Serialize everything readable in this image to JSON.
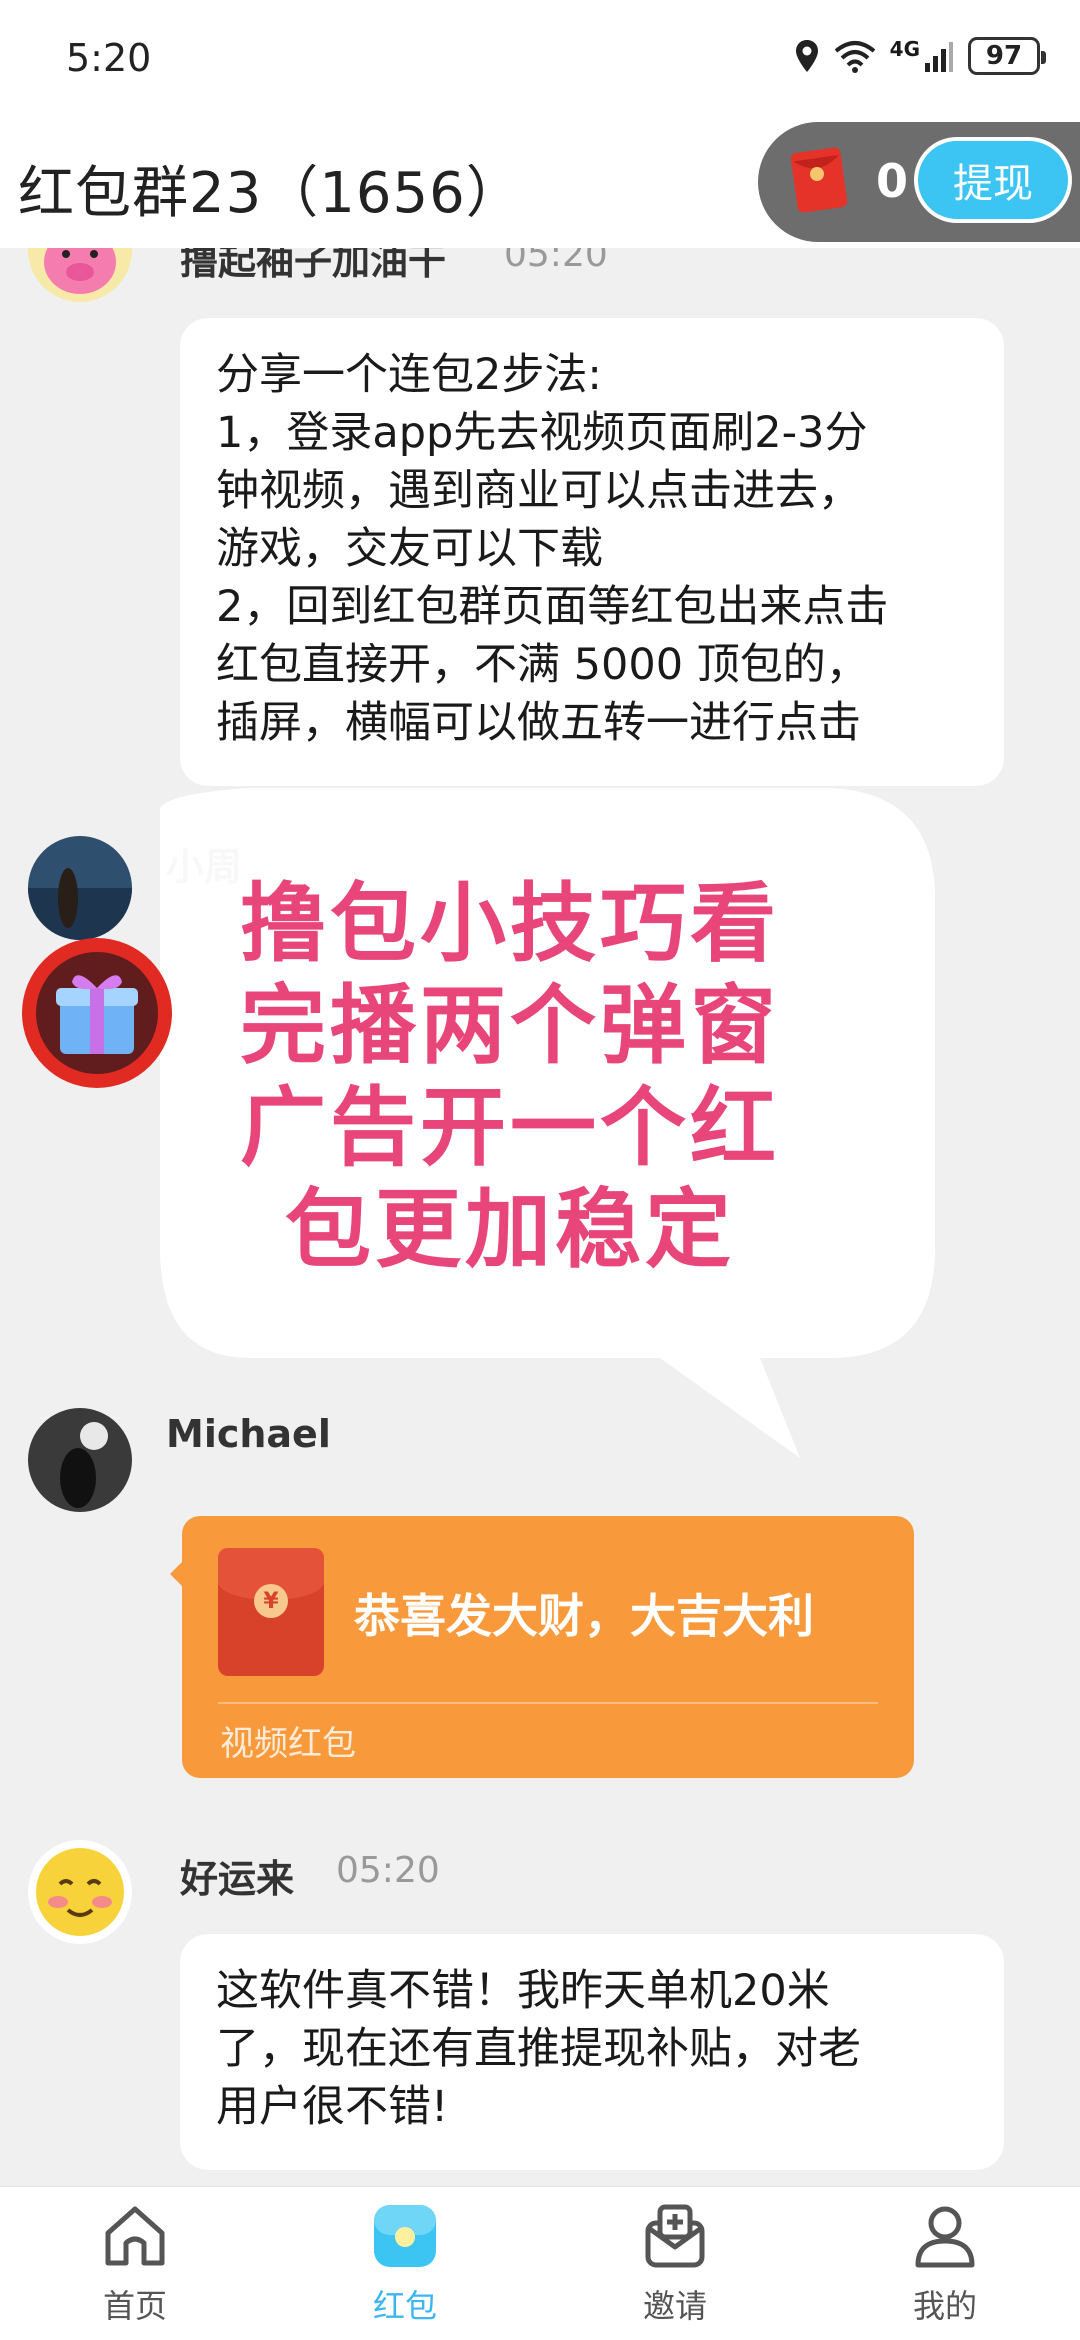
{
  "status_bar": {
    "time": "5:20",
    "battery": "97",
    "network": "4G"
  },
  "header": {
    "title": "红包群23（1656）",
    "wallet_count": "0",
    "withdraw_label": "提现"
  },
  "messages": [
    {
      "sender": "撸起袖子加油干",
      "time": "05:20",
      "lines": [
        "分享一个连包2步法:",
        "1，登录app先去视频页面刷2-3分",
        "钟视频，遇到商业可以点击进去，",
        "游戏，交友可以下载",
        "2，回到红包群页面等红包出来点击",
        "红包直接开，不满 5000 顶包的，",
        "插屏，横幅可以做五转一进行点击"
      ]
    },
    {
      "sender": "小周"
    },
    {
      "sender": "Michael",
      "packet_text": "恭喜发大财，大吉大利",
      "packet_type": "视频红包",
      "packet_symbol": "¥"
    },
    {
      "sender": "好运来",
      "time": "05:20",
      "lines": [
        "这软件真不错！我昨天单机20米",
        "了，现在还有直推提现补贴，对老",
        "用户很不错!"
      ]
    }
  ],
  "overlay": {
    "lines": [
      "撸包小技巧看",
      "完播两个弹窗",
      "广告开一个红",
      "包更加稳定"
    ]
  },
  "bottom_nav": [
    {
      "label": "首页",
      "icon": "home-icon",
      "active": false
    },
    {
      "label": "红包",
      "icon": "red-packet-tab-icon",
      "active": true
    },
    {
      "label": "邀请",
      "icon": "invite-icon",
      "active": false
    },
    {
      "label": "我的",
      "icon": "profile-icon",
      "active": false
    }
  ],
  "colors": {
    "accent": "#3cc4f3",
    "packet": "#f89a3c",
    "overlay_text": "#e8467a",
    "header_pill": "#6d6d6d"
  }
}
